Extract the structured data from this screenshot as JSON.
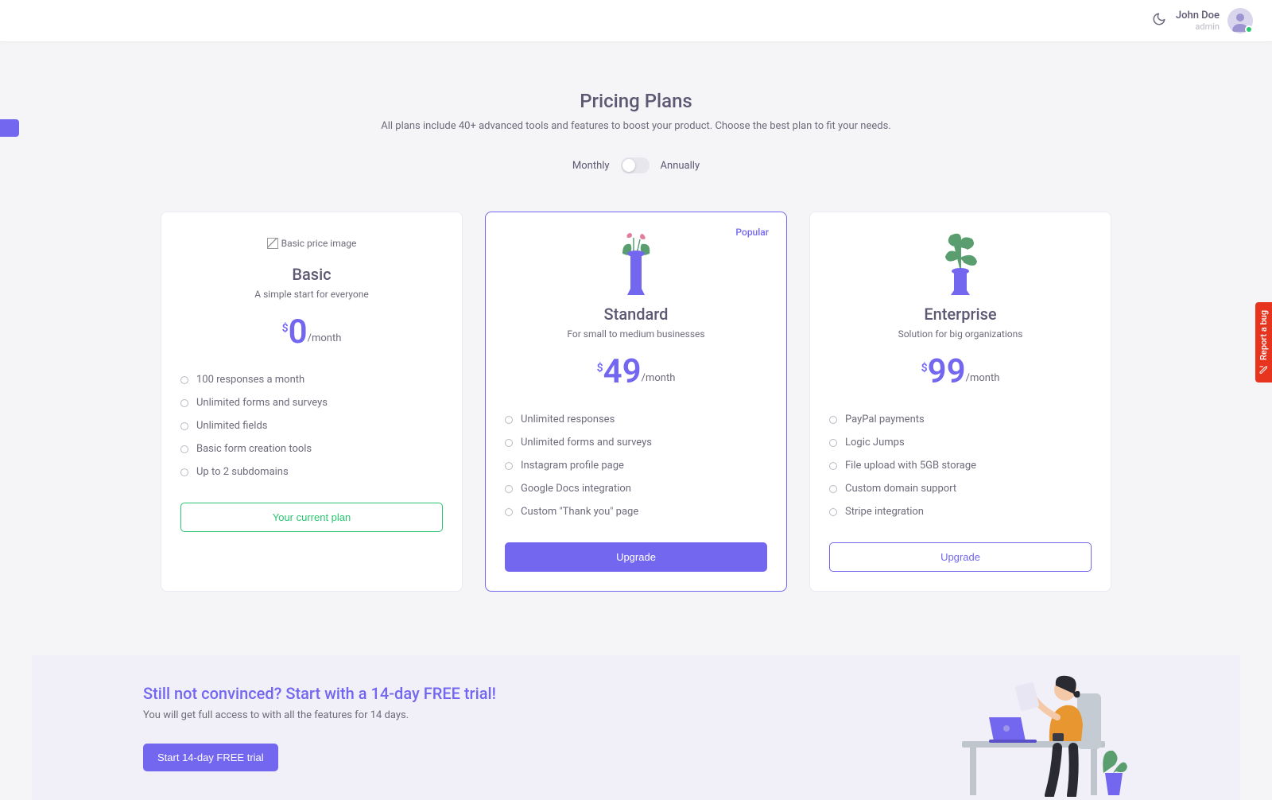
{
  "header": {
    "user_name": "John Doe",
    "user_role": "admin"
  },
  "page": {
    "title": "Pricing Plans",
    "subtitle": "All plans include 40+ advanced tools and features to boost your product. Choose the best plan to fit your needs.",
    "toggle_left": "Monthly",
    "toggle_right": "Annually"
  },
  "report_bug_label": "Report a bug",
  "plans": [
    {
      "name": "Basic",
      "desc": "A simple start for everyone",
      "currency": "$",
      "price": "0",
      "period": "/month",
      "img_alt": "Basic price image",
      "popular": false,
      "features": [
        "100 responses a month",
        "Unlimited forms and surveys",
        "Unlimited fields",
        "Basic form creation tools",
        "Up to 2 subdomains"
      ],
      "cta": "Your current plan",
      "cta_style": "outline-success"
    },
    {
      "name": "Standard",
      "desc": "For small to medium businesses",
      "currency": "$",
      "price": "49",
      "period": "/month",
      "popular": true,
      "popular_label": "Popular",
      "features": [
        "Unlimited responses",
        "Unlimited forms and surveys",
        "Instagram profile page",
        "Google Docs integration",
        "Custom \"Thank you\" page"
      ],
      "cta": "Upgrade",
      "cta_style": "primary"
    },
    {
      "name": "Enterprise",
      "desc": "Solution for big organizations",
      "currency": "$",
      "price": "99",
      "period": "/month",
      "popular": false,
      "features": [
        "PayPal payments",
        "Logic Jumps",
        "File upload with 5GB storage",
        "Custom domain support",
        "Stripe integration"
      ],
      "cta": "Upgrade",
      "cta_style": "outline-primary"
    }
  ],
  "trial": {
    "title": "Still not convinced? Start with a 14-day FREE trial!",
    "subtitle": "You will get full access to with all the features for 14 days.",
    "cta": "Start 14-day FREE trial"
  }
}
